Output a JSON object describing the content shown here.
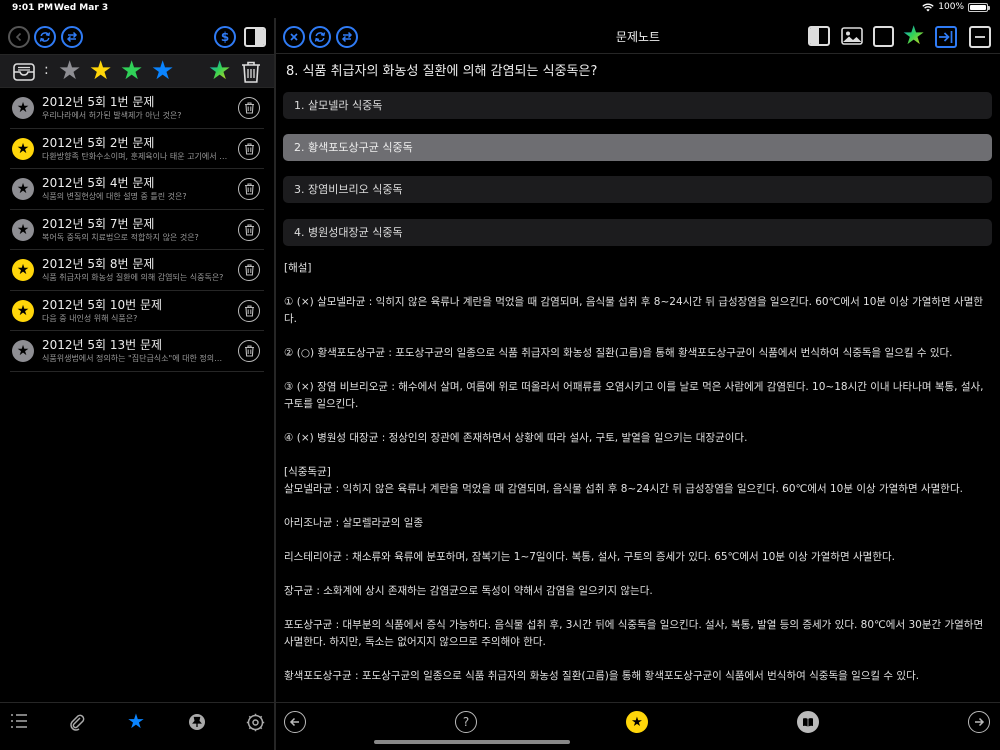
{
  "status": {
    "time": "9:01 PM",
    "date": "Wed Mar 3",
    "battery": "100%",
    "battery_level": 1.0
  },
  "sidebar": {
    "filter_colon": ":",
    "items": [
      {
        "title": "2012년 5회  1번 문제",
        "sub": "우리나라에서 허가된 발색제가 아닌 것은?",
        "starred": false
      },
      {
        "title": "2012년 5회  2번 문제",
        "sub": "다환방향족 탄화수소이며, 훈제육이나 태운 고기에서 다량 검출되는 물질은?",
        "starred": true
      },
      {
        "title": "2012년 5회  4번 문제",
        "sub": "식품의 변질현상에 대한 설명 중 틀린 것은?",
        "starred": false
      },
      {
        "title": "2012년 5회  7번 문제",
        "sub": "복어독 중독의 치료법으로 적합하지 않은 것은?",
        "starred": false
      },
      {
        "title": "2012년 5회  8번 문제",
        "sub": "식품 취급자의 화농성 질환에 의해 감염되는 식중독은?",
        "starred": true
      },
      {
        "title": "2012년 5회  10번 문제",
        "sub": "다음 중 내인성 위해 식품은?",
        "starred": true
      },
      {
        "title": "2012년 5회  13번 문제",
        "sub": "식품위생법에서 정의하는 \"집단급식소\"에 대한 정의로 옳은 것은?",
        "starred": false
      }
    ]
  },
  "main": {
    "title": "문제노트",
    "question": "8. 식품 취급자의 화농성 질환에 의해 감염되는 식중독은?",
    "choices": [
      {
        "label": "1. 살모넬라 식중독",
        "selected": false
      },
      {
        "label": "2. 황색포도상구균 식중독",
        "selected": true
      },
      {
        "label": "3. 장염비브리오 식중독",
        "selected": false
      },
      {
        "label": "4. 병원성대장균 식중독",
        "selected": false
      }
    ],
    "explanation": {
      "header": "[해설]",
      "p1": "① (×) 살모넬라균 : 익히지 않은 육류나 계란을 먹었을 때 감염되며, 음식물 섭취 후 8~24시간 뒤 급성장염을 일으킨다. 60℃에서 10분 이상 가열하면 사멸한다.",
      "p2": "② (○) 황색포도상구균 : 포도상구균의 일종으로 식품 취급자의 화농성 질환(고름)을 통해 황색포도상구균이 식품에서 번식하여 식중독을 일으킬 수 있다.",
      "p3": "③ (×) 장염 비브리오균 : 해수에서 살며, 여름에 위로 떠올라서 어패류를 오염시키고 이를 날로 먹은 사람에게 감염된다. 10~18시간 이내 나타나며 복통, 설사, 구토를 일으킨다.",
      "p4": "④ (×) 병원성 대장균 : 정상인의 장관에 존재하면서 상황에 따라 설사, 구토, 발열을 일으키는 대장균이다.",
      "section": "[식중독균]",
      "s1": "살모넬라균 : 익히지 않은 육류나 계란을 먹었을 때 감염되며, 음식물 섭취 후 8~24시간 뒤 급성장염을 일으킨다. 60℃에서 10분 이상 가열하면 사멸한다.",
      "s2": "아리조나균 : 살모렐라균의 일종",
      "s3": "리스테리아균 : 채소류와 육류에 분포하며, 잠복기는 1~7일이다. 복통, 설사, 구토의 증세가 있다. 65℃에서 10분 이상 가열하면 사멸한다.",
      "s4": "장구균 : 소화계에 상시 존재하는 감염균으로 독성이 약해서 감염을 일으키지 않는다.",
      "s5": "포도상구균 : 대부분의 식품에서 증식 가능하다. 음식물 섭취 후, 3시간 뒤에 식중독을 일으킨다. 설사, 복통, 발열 등의 증세가 있다. 80℃에서 30분간 가열하면 사멸한다. 하지만, 독소는 없어지지 않으므로 주의해야 한다.",
      "s6": "황색포도상구균 : 포도상구균의 일종으로 식품 취급자의 화농성 질환(고름)을 통해 황색포도상구균이 식품에서 번식하여 식중독을 일으킬 수 있다."
    }
  },
  "colors": {
    "accent": "#2f7bf5",
    "star_yellow": "#ffd60a",
    "star_green": "#30d158",
    "star_blue": "#0a84ff",
    "star_gray": "#8e8e93"
  }
}
